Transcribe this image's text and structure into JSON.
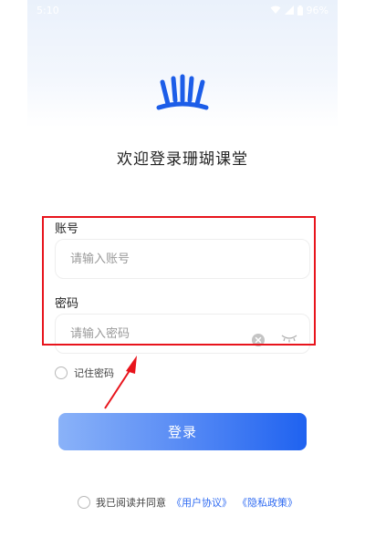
{
  "status_bar": {
    "time": "5:10",
    "battery": "96%"
  },
  "app": {
    "welcome_text": "欢迎登录珊瑚课堂"
  },
  "form": {
    "account_label": "账号",
    "account_placeholder": "请输入账号",
    "password_label": "密码",
    "password_placeholder": "请输入密码",
    "remember_label": "记住密码"
  },
  "login_button_label": "登录",
  "agreement": {
    "prefix": "我已阅读并同意",
    "user_agreement": "《用户协议》",
    "privacy_policy": "《隐私政策》"
  },
  "colors": {
    "accent": "#1f62f0",
    "link": "#2f6bf2",
    "annotation": "#e8141c"
  },
  "icons": [
    "logo-icon",
    "wifi-icon",
    "signal-icon",
    "battery-icon",
    "clear-icon",
    "eye-closed-icon",
    "radio-icon",
    "arrow-annotation"
  ]
}
